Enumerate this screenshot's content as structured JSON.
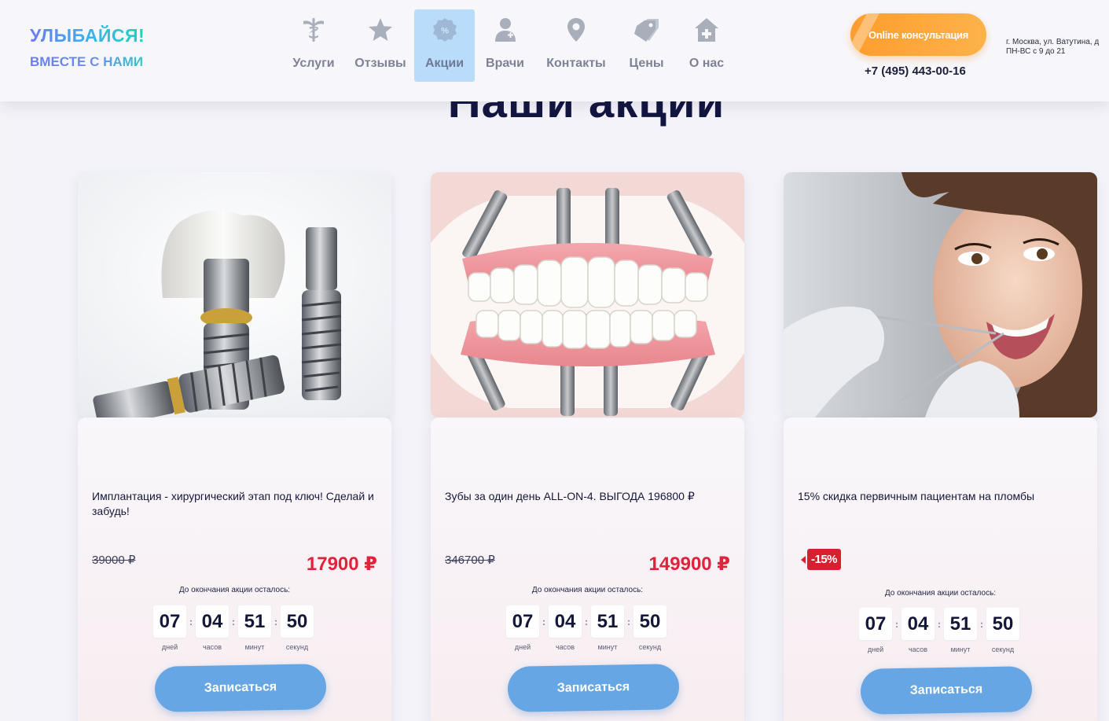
{
  "logo": {
    "line1": "УЛЫБАЙСЯ!",
    "line2": "ВМЕСТЕ С НАМИ"
  },
  "nav": [
    {
      "label": "Услуги",
      "icon": "caduceus-icon",
      "active": false
    },
    {
      "label": "Отзывы",
      "icon": "star-icon",
      "active": false
    },
    {
      "label": "Акции",
      "icon": "percent-badge-icon",
      "active": true
    },
    {
      "label": "Врачи",
      "icon": "doctor-icon",
      "active": false
    },
    {
      "label": "Контакты",
      "icon": "location-pin-icon",
      "active": false
    },
    {
      "label": "Цены",
      "icon": "price-tag-icon",
      "active": false
    },
    {
      "label": "О нас",
      "icon": "clinic-house-icon",
      "active": false
    }
  ],
  "header": {
    "consult_label": "Online консультация",
    "phone": "+7 (495) 443-00-16",
    "address_line1": "г. Москва, ул. Ватутина, д",
    "address_line2": "ПН-ВС с 9 до 21"
  },
  "section_title": "Наши акции",
  "colors": {
    "price_red": "#e0223a",
    "button_blue": "#67a6e4",
    "consult_orange": "#ff9d2e",
    "active_nav": "#b9dcfa"
  },
  "cards": [
    {
      "image": "dental-implants-image",
      "title": "Имплантация - хирургический этап под ключ! Сделай и забудь!",
      "old_price": "39000 ₽",
      "new_price": "17900 ₽",
      "countdown_label": "До окончания акции осталось:",
      "timer": {
        "days": "07",
        "hours": "04",
        "minutes": "51",
        "seconds": "50"
      },
      "timer_caps": {
        "days": "дней",
        "hours": "часов",
        "minutes": "минут",
        "seconds": "секунд"
      },
      "button": "Записаться"
    },
    {
      "image": "all-on-4-jaw-image",
      "title": "Зубы за один день ALL-ON-4. ВЫГОДА 196800 ₽",
      "old_price": "346700 ₽",
      "new_price": "149900 ₽",
      "countdown_label": "До окончания акции осталось:",
      "timer": {
        "days": "07",
        "hours": "04",
        "minutes": "51",
        "seconds": "50"
      },
      "timer_caps": {
        "days": "дней",
        "hours": "часов",
        "minutes": "минут",
        "seconds": "секунд"
      },
      "button": "Записаться"
    },
    {
      "image": "smiling-patient-image",
      "title": "15% скидка первичным пациентам на пломбы",
      "badge": "-15%",
      "countdown_label": "До окончания акции осталось:",
      "timer": {
        "days": "07",
        "hours": "04",
        "minutes": "51",
        "seconds": "50"
      },
      "timer_caps": {
        "days": "дней",
        "hours": "часов",
        "minutes": "минут",
        "seconds": "секунд"
      },
      "button": "Записаться"
    }
  ]
}
